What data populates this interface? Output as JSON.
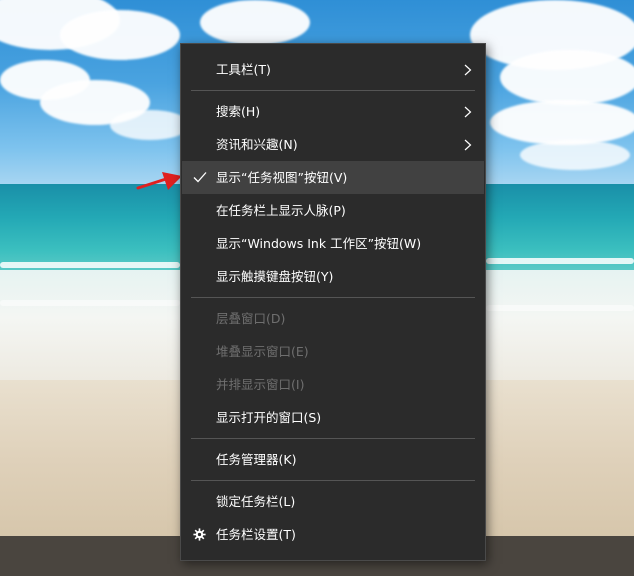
{
  "context_menu": {
    "items": [
      {
        "label": "工具栏(T)",
        "submenu": true
      },
      {
        "label": "搜索(H)",
        "submenu": true
      },
      {
        "label": "资讯和兴趣(N)",
        "submenu": true
      },
      {
        "label": "显示“任务视图”按钮(V)",
        "checked": true
      },
      {
        "label": "在任务栏上显示人脉(P)"
      },
      {
        "label": "显示“Windows Ink 工作区”按钮(W)"
      },
      {
        "label": "显示触摸键盘按钮(Y)"
      },
      {
        "label": "层叠窗口(D)",
        "disabled": true
      },
      {
        "label": "堆叠显示窗口(E)",
        "disabled": true
      },
      {
        "label": "并排显示窗口(I)",
        "disabled": true
      },
      {
        "label": "显示打开的窗口(S)"
      },
      {
        "label": "任务管理器(K)"
      },
      {
        "label": "锁定任务栏(L)"
      },
      {
        "label": "任务栏设置(T)",
        "icon": "gear-icon"
      }
    ]
  },
  "annotation": {
    "icon": "red-arrow-icon",
    "color": "#e02020"
  },
  "colors": {
    "menu_bg": "#2b2b2b",
    "menu_hover": "#414141",
    "menu_text": "#ffffff",
    "menu_disabled_text": "#6f6f6f",
    "separator": "#555555"
  }
}
